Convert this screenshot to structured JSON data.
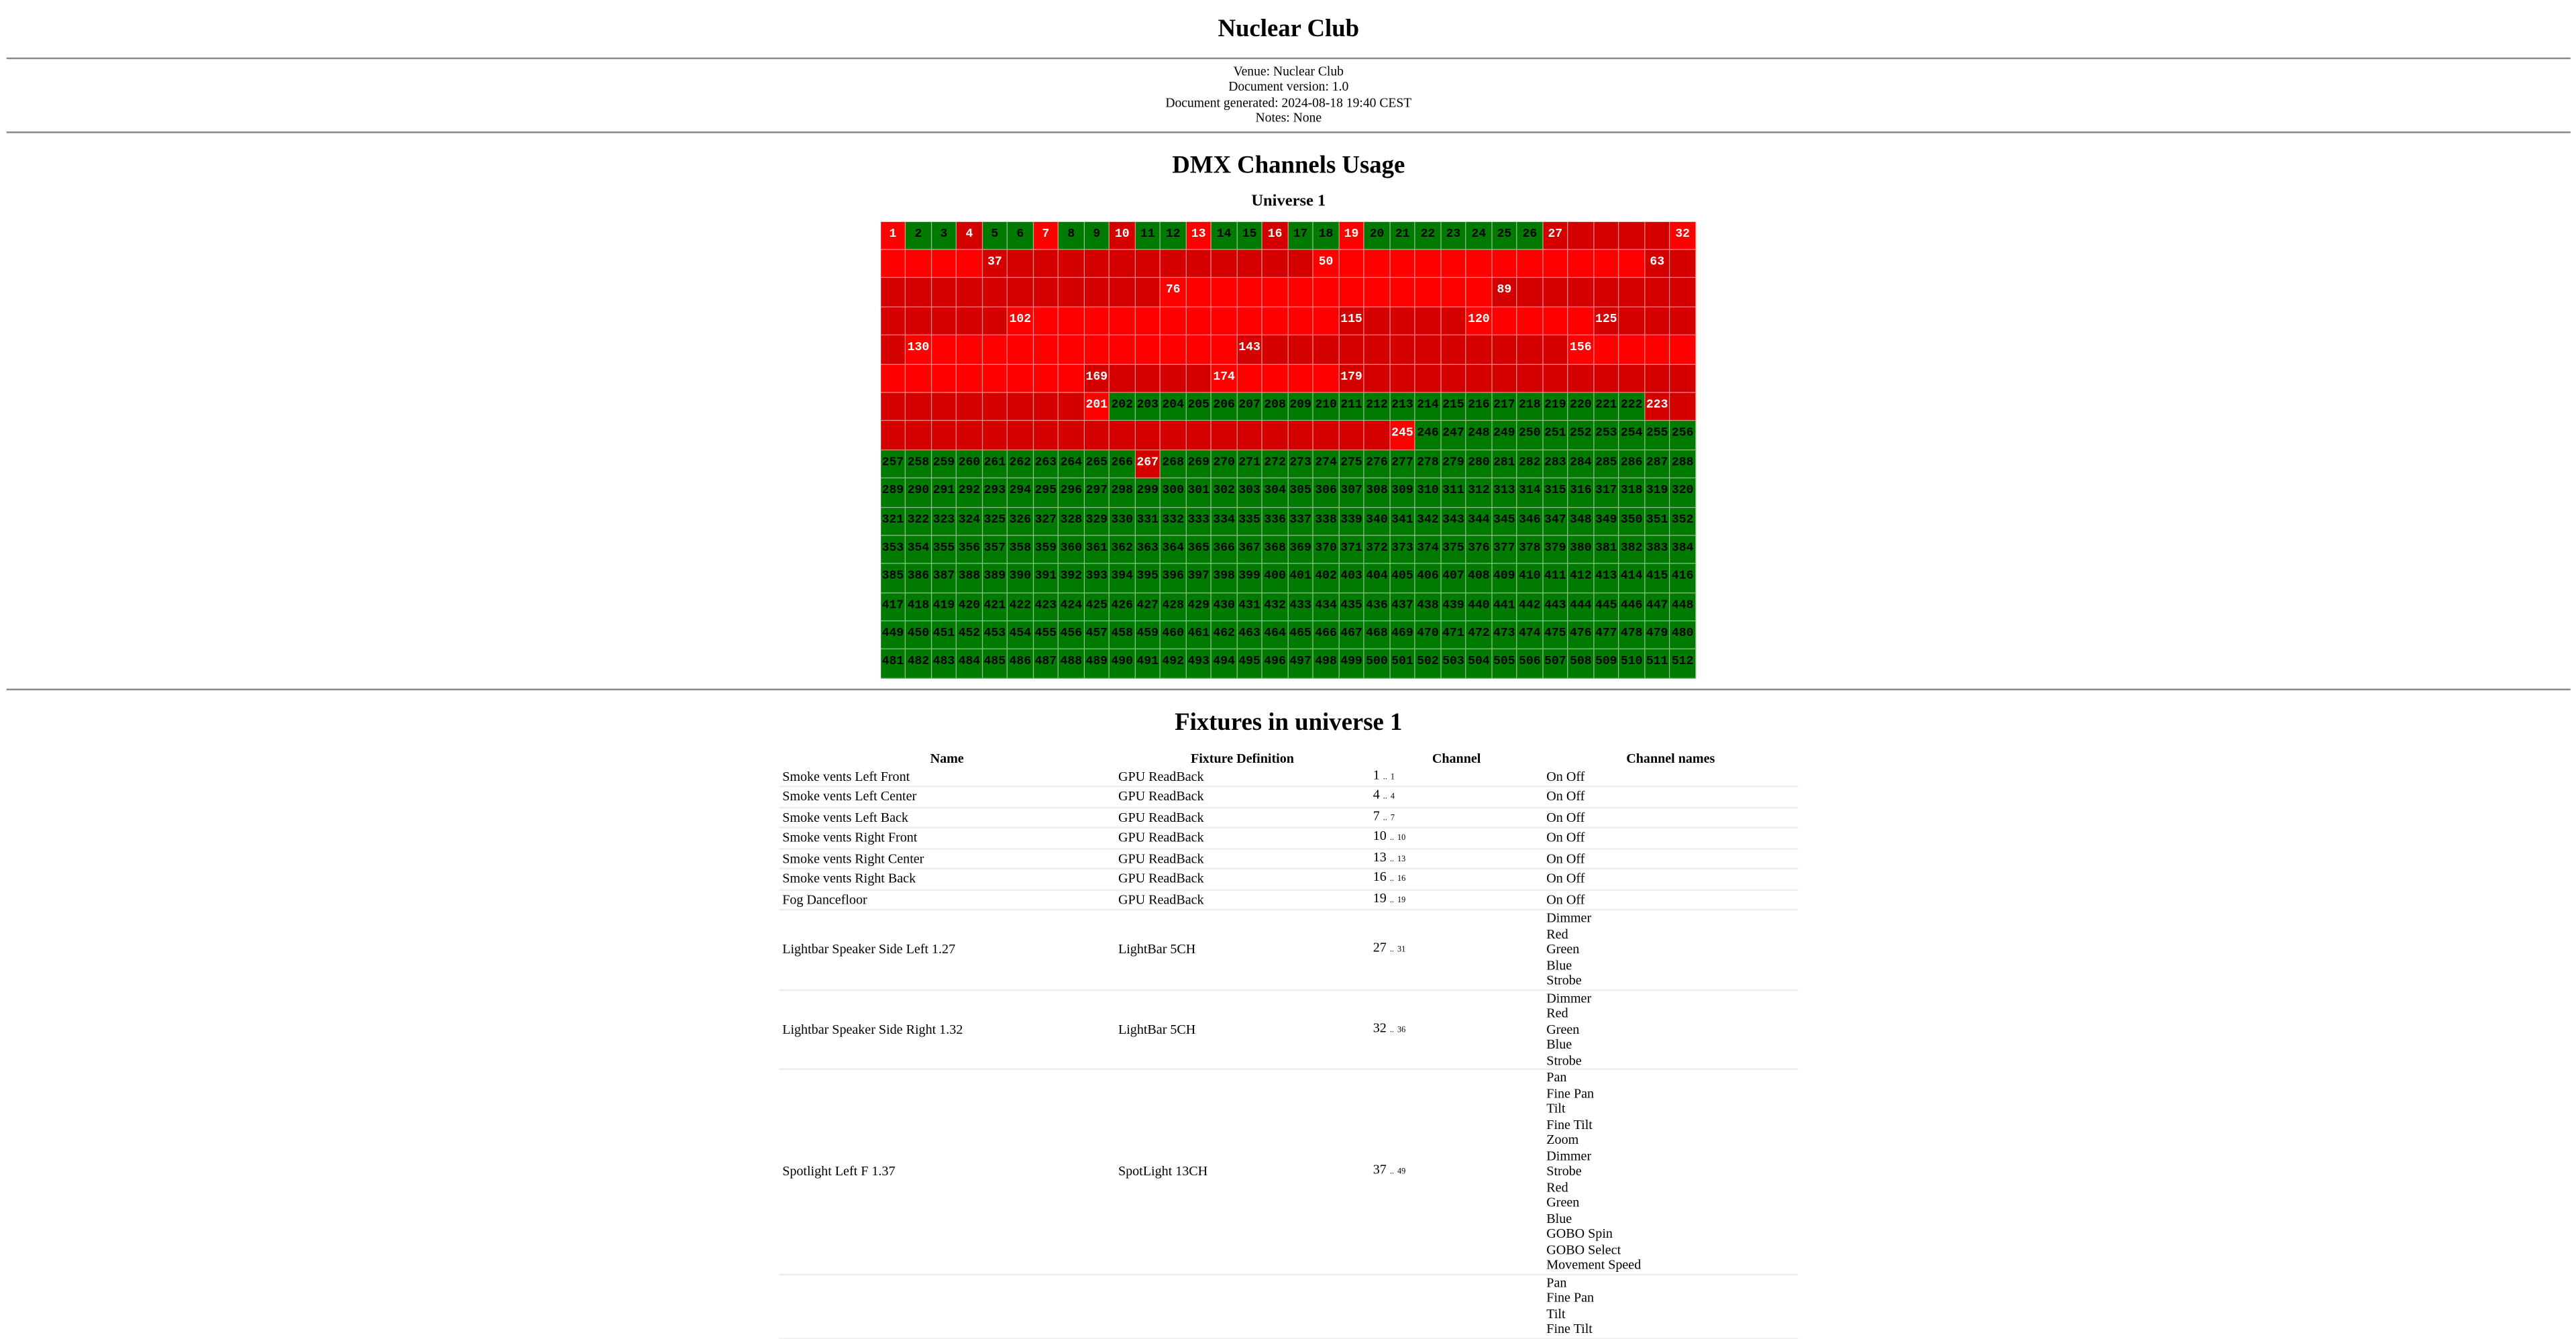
{
  "document": {
    "title": "Nuclear Club",
    "meta": [
      "Venue: Nuclear Club",
      "Document version: 1.0",
      "Document generated: 2024-08-18 19:40 CEST",
      "Notes: None"
    ]
  },
  "channels_section": {
    "title": "DMX Channels Usage",
    "universe_label": "Universe 1",
    "total_channels": 512,
    "used_ranges": [
      [
        1,
        1
      ],
      [
        4,
        4
      ],
      [
        7,
        7
      ],
      [
        10,
        10
      ],
      [
        13,
        13
      ],
      [
        16,
        16
      ],
      [
        19,
        19
      ],
      [
        27,
        201
      ],
      [
        223,
        245
      ],
      [
        267,
        267
      ]
    ],
    "fixture_start_channels": [
      1,
      4,
      7,
      10,
      13,
      16,
      19,
      27,
      32,
      37,
      50,
      63,
      76,
      89,
      102,
      115,
      120,
      125,
      130,
      143,
      156,
      169,
      174,
      179,
      201,
      223,
      245,
      267
    ],
    "colors": {
      "free": "#007a00",
      "used": "#ff0000",
      "used_alt": "#d40000"
    }
  },
  "fixtures_section": {
    "title": "Fixtures in universe 1",
    "headers": {
      "name": "Name",
      "definition": "Fixture Definition",
      "channel": "Channel",
      "channel_names": "Channel names"
    },
    "range_separator": "..",
    "fixtures": [
      {
        "name": "Smoke vents Left Front",
        "definition": "GPU ReadBack",
        "start": "1",
        "end": "1",
        "channel_names": [
          "On Off"
        ]
      },
      {
        "name": "Smoke vents Left Center",
        "definition": "GPU ReadBack",
        "start": "4",
        "end": "4",
        "channel_names": [
          "On Off"
        ]
      },
      {
        "name": "Smoke vents Left Back",
        "definition": "GPU ReadBack",
        "start": "7",
        "end": "7",
        "channel_names": [
          "On Off"
        ]
      },
      {
        "name": "Smoke vents Right Front",
        "definition": "GPU ReadBack",
        "start": "10",
        "end": "10",
        "channel_names": [
          "On Off"
        ]
      },
      {
        "name": "Smoke vents Right Center",
        "definition": "GPU ReadBack",
        "start": "13",
        "end": "13",
        "channel_names": [
          "On Off"
        ]
      },
      {
        "name": "Smoke vents Right Back",
        "definition": "GPU ReadBack",
        "start": "16",
        "end": "16",
        "channel_names": [
          "On Off"
        ]
      },
      {
        "name": "Fog Dancefloor",
        "definition": "GPU ReadBack",
        "start": "19",
        "end": "19",
        "channel_names": [
          "On Off"
        ]
      },
      {
        "name": "Lightbar Speaker Side Left 1.27",
        "definition": "LightBar 5CH",
        "start": "27",
        "end": "31",
        "channel_names": [
          "Dimmer",
          "Red",
          "Green",
          "Blue",
          "Strobe"
        ]
      },
      {
        "name": "Lightbar Speaker Side Right 1.32",
        "definition": "LightBar 5CH",
        "start": "32",
        "end": "36",
        "channel_names": [
          "Dimmer",
          "Red",
          "Green",
          "Blue",
          "Strobe"
        ]
      },
      {
        "name": "Spotlight Left F 1.37",
        "definition": "SpotLight 13CH",
        "start": "37",
        "end": "49",
        "channel_names": [
          "Pan",
          "Fine Pan",
          "Tilt",
          "Fine Tilt",
          "Zoom",
          "Dimmer",
          "Strobe",
          "Red",
          "Green",
          "Blue",
          "GOBO Spin",
          "GOBO Select",
          "Movement Speed"
        ]
      },
      {
        "name": "",
        "definition": "",
        "start": "",
        "end": "",
        "channel_names": [
          "Pan",
          "Fine Pan",
          "Tilt",
          "Fine Tilt"
        ]
      }
    ]
  }
}
